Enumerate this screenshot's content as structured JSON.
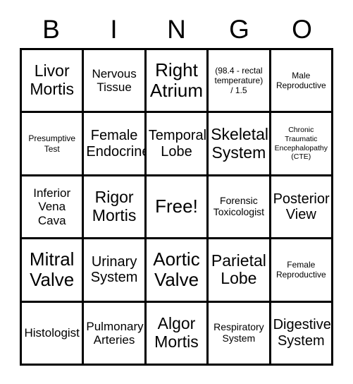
{
  "card": {
    "header_letters": [
      "B",
      "I",
      "N",
      "G",
      "O"
    ],
    "columns": 5,
    "rows": 5,
    "free_space_label": "Free!",
    "border_color": "#000000",
    "background_color": "#ffffff",
    "text_color": "#000000",
    "cells": [
      {
        "text": "Livor\nMortis",
        "size": "fs-xl"
      },
      {
        "text": "Nervous\nTissue",
        "size": "fs-m"
      },
      {
        "text": "Right\nAtrium",
        "size": "fs-xxl"
      },
      {
        "text": "(98.4 - rectal\ntemperature)\n/ 1.5",
        "size": "fs-xs"
      },
      {
        "text": "Male\nReproductive",
        "size": "fs-xs"
      },
      {
        "text": "Presumptive\nTest",
        "size": "fs-xs"
      },
      {
        "text": "Female\nEndocrine",
        "size": "fs-l"
      },
      {
        "text": "Temporal\nLobe",
        "size": "fs-l"
      },
      {
        "text": "Skeletal\nSystem",
        "size": "fs-xl"
      },
      {
        "text": "Chronic\nTraumatic\nEncephalopathy\n(CTE)",
        "size": "fs-xxs"
      },
      {
        "text": "Inferior\nVena\nCava",
        "size": "fs-m"
      },
      {
        "text": "Rigor\nMortis",
        "size": "fs-xl"
      },
      {
        "text": "Free!",
        "size": "fs-xxl"
      },
      {
        "text": "Forensic\nToxicologist",
        "size": "fs-s"
      },
      {
        "text": "Posterior\nView",
        "size": "fs-l"
      },
      {
        "text": "Mitral\nValve",
        "size": "fs-xxl"
      },
      {
        "text": "Urinary\nSystem",
        "size": "fs-l"
      },
      {
        "text": "Aortic\nValve",
        "size": "fs-xxl"
      },
      {
        "text": "Parietal\nLobe",
        "size": "fs-xl"
      },
      {
        "text": "Female\nReproductive",
        "size": "fs-xs"
      },
      {
        "text": "Histologist",
        "size": "fs-m"
      },
      {
        "text": "Pulmonary\nArteries",
        "size": "fs-m"
      },
      {
        "text": "Algor\nMortis",
        "size": "fs-xl"
      },
      {
        "text": "Respiratory\nSystem",
        "size": "fs-s"
      },
      {
        "text": "Digestive\nSystem",
        "size": "fs-l"
      }
    ]
  }
}
